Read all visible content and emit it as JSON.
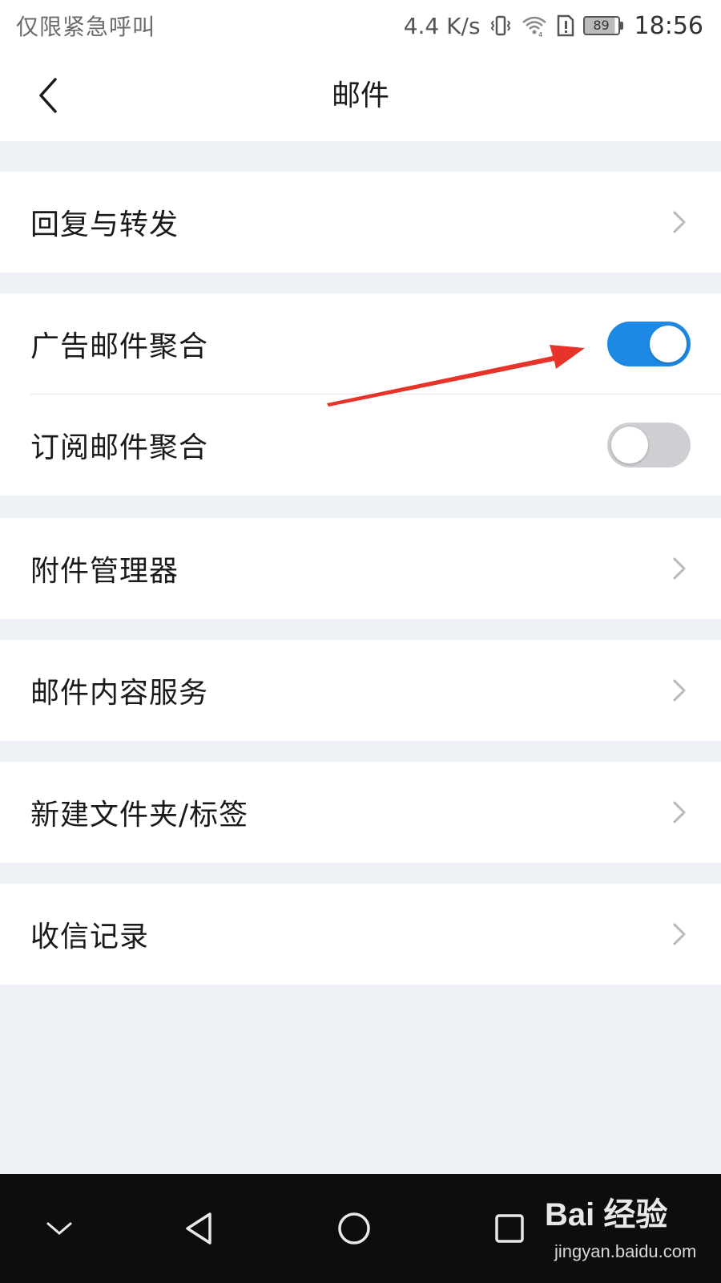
{
  "status_bar": {
    "carrier": "仅限紧急呼叫",
    "speed": "4.4 K/s",
    "battery": "89",
    "time": "18:56"
  },
  "header": {
    "title": "邮件"
  },
  "settings": {
    "reply_forward": "回复与转发",
    "ad_mail_aggregate": {
      "label": "广告邮件聚合",
      "enabled": true
    },
    "subscription_aggregate": {
      "label": "订阅邮件聚合",
      "enabled": false
    },
    "attachment_manager": "附件管理器",
    "mail_content_service": "邮件内容服务",
    "new_folder_label": "新建文件夹/标签",
    "receive_log": "收信记录"
  },
  "colors": {
    "toggle_on": "#1e88e5",
    "toggle_off": "#cfcfd3",
    "annotation_arrow": "#e8332a"
  },
  "watermark": {
    "logo": "Bai 经验",
    "url": "jingyan.baidu.com"
  }
}
